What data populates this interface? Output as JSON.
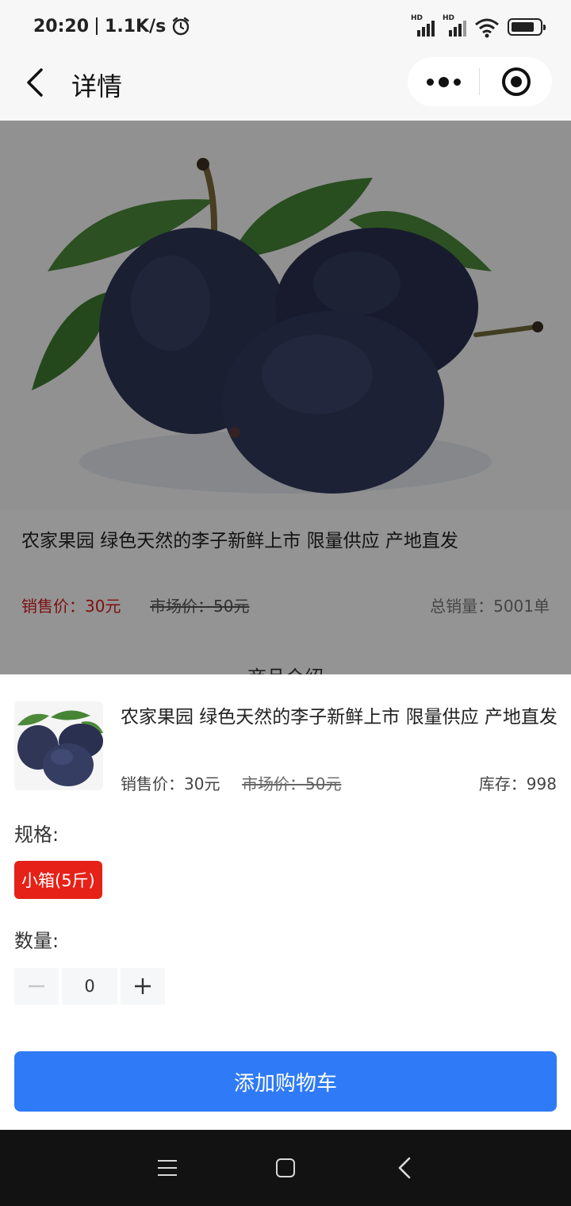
{
  "status_bar": {
    "time": "20:20",
    "net_speed": "1.1K/s",
    "hd_label_1": "HD",
    "hd_label_2": "HD"
  },
  "nav": {
    "title": "详情"
  },
  "product_page": {
    "title": "农家果园 绿色天然的李子新鲜上市 限量供应 产地直发",
    "sale_price": "销售价：30元",
    "market_price": "市场价：50元",
    "total_sales": "总销量：5001单",
    "section_title": "商品介绍"
  },
  "sheet": {
    "product_title": "农家果园 绿色天然的李子新鲜上市 限量供应 产地直发",
    "sale_price": "销售价：30元",
    "market_price": "市场价：50元",
    "stock": "库存：998",
    "spec_label": "规格:",
    "spec_option": "小箱(5斤)",
    "quantity_label": "数量:",
    "quantity_value": "0",
    "add_to_cart": "添加购物车"
  },
  "colors": {
    "accent_blue": "#2f7bf7",
    "spec_red": "#e62118",
    "price_red": "#d91b1b"
  }
}
